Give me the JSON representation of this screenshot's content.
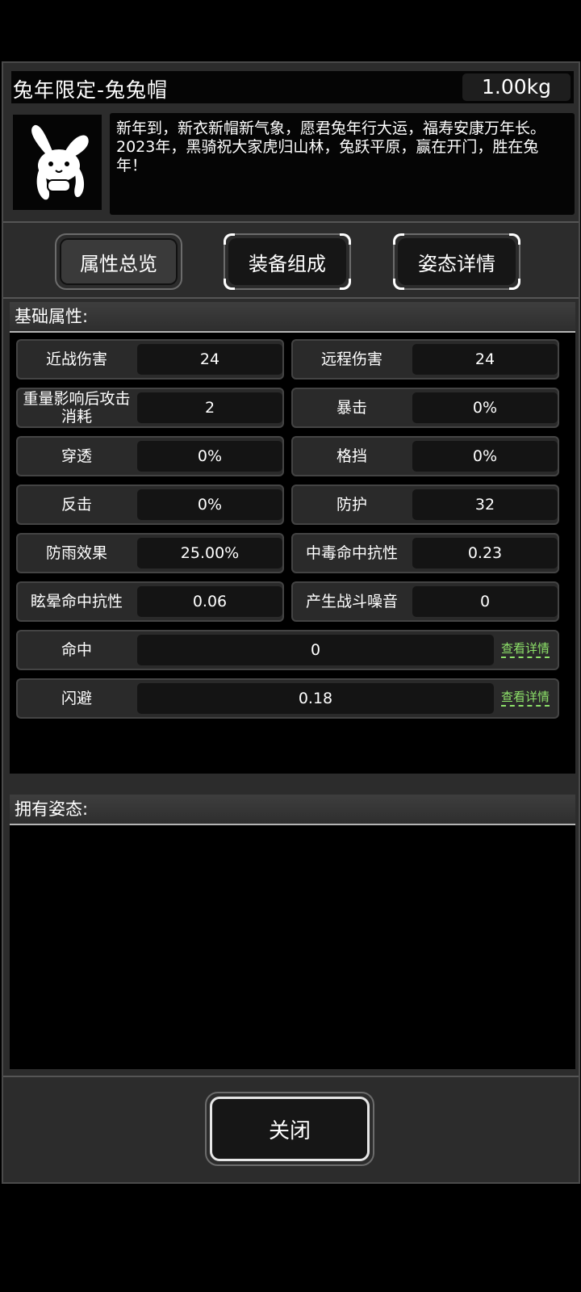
{
  "item": {
    "title": "兔年限定-兔兔帽",
    "weight": "1.00kg",
    "description": "新年到，新衣新帽新气象，愿君兔年行大运，福寿安康万年长。2023年，黑骑祝大家虎归山林，兔跃平原，赢在开门，胜在兔年！",
    "icon": "rabbit-hat-icon"
  },
  "tabs": [
    {
      "label": "属性总览",
      "active": true
    },
    {
      "label": "装备组成",
      "active": false
    },
    {
      "label": "姿态详情",
      "active": false
    }
  ],
  "basic_section": {
    "title": "基础属性:",
    "stats": [
      {
        "label": "近战伤害",
        "value": "24"
      },
      {
        "label": "远程伤害",
        "value": "24"
      },
      {
        "label": "重量影响后攻击消耗",
        "value": "2"
      },
      {
        "label": "暴击",
        "value": "0%"
      },
      {
        "label": "穿透",
        "value": "0%"
      },
      {
        "label": "格挡",
        "value": "0%"
      },
      {
        "label": "反击",
        "value": "0%"
      },
      {
        "label": "防护",
        "value": "32"
      },
      {
        "label": "防雨效果",
        "value": "25.00%"
      },
      {
        "label": "中毒命中抗性",
        "value": "0.23"
      },
      {
        "label": "眩晕命中抗性",
        "value": "0.06"
      },
      {
        "label": "产生战斗噪音",
        "value": "0"
      }
    ],
    "wide_stats": [
      {
        "label": "命中",
        "value": "0",
        "link": "查看详情"
      },
      {
        "label": "闪避",
        "value": "0.18",
        "link": "查看详情"
      }
    ]
  },
  "stance_section": {
    "title": "拥有姿态:"
  },
  "close_label": "关闭",
  "colors": {
    "panel": "#2c2c2c",
    "link": "#8ee26a"
  }
}
